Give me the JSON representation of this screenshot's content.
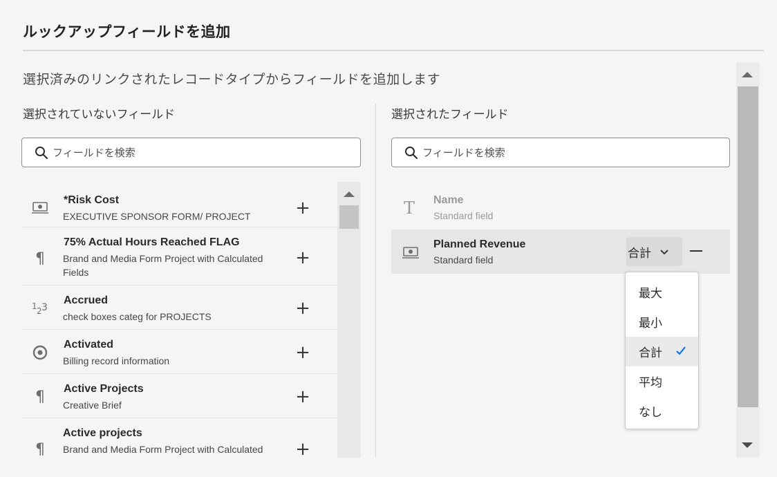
{
  "dialog": {
    "title": "ルックアップフィールドを追加",
    "subtitle": "選択済みのリンクされたレコードタイプからフィールドを追加します"
  },
  "left_column": {
    "title": "選択されていないフィールド",
    "search_placeholder": "フィールドを検索",
    "items": [
      {
        "icon": "currency-icon",
        "name": "*Risk Cost",
        "desc": "EXECUTIVE SPONSOR FORM/ PROJECT"
      },
      {
        "icon": "paragraph-icon",
        "name": "75% Actual Hours Reached FLAG",
        "desc": "Brand and Media Form Project with Calculated Fields"
      },
      {
        "icon": "number-icon",
        "name": "Accrued",
        "desc": "check boxes categ for PROJECTS"
      },
      {
        "icon": "radio-icon",
        "name": "Activated",
        "desc": "Billing record information"
      },
      {
        "icon": "paragraph-icon",
        "name": "Active Projects",
        "desc": "Creative Brief"
      },
      {
        "icon": "paragraph-icon",
        "name": "Active projects",
        "desc": "Brand and Media Form Project with Calculated"
      }
    ]
  },
  "right_column": {
    "title": "選択されたフィールド",
    "search_placeholder": "フィールドを検索",
    "items": [
      {
        "icon": "text-type-icon",
        "name": "Name",
        "desc": "Standard field"
      },
      {
        "icon": "currency-icon",
        "name": "Planned Revenue",
        "desc": "Standard field",
        "aggregation": "合計"
      }
    ]
  },
  "aggregation_dropdown": {
    "options": [
      "最大",
      "最小",
      "合計",
      "平均",
      "なし"
    ],
    "selected": "合計"
  },
  "colors": {
    "background": "#f5f5f5",
    "check_blue": "#1473e6"
  }
}
